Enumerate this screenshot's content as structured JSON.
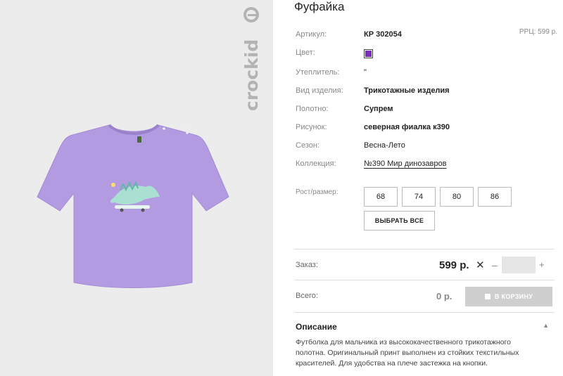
{
  "brand": {
    "name": "crockid"
  },
  "product": {
    "title": "Фуфайка",
    "rrp": "РРЦ: 599 р.",
    "specs": {
      "article": {
        "key": "Артикул:",
        "value": "КР 302054"
      },
      "color": {
        "key": "Цвет:",
        "hex": "#7b2cbf"
      },
      "insulation": {
        "key": "Утеплитель:",
        "value": "\""
      },
      "kind": {
        "key": "Вид изделия:",
        "value": "Трикотажные изделия"
      },
      "fabric": {
        "key": "Полотно:",
        "value": "Супрем"
      },
      "pattern": {
        "key": "Рисунок:",
        "value": "северная фиалка к390"
      },
      "season": {
        "key": "Сезон:",
        "value": "Весна-Лето"
      },
      "collection": {
        "key": "Коллекция:",
        "value": "№390 Мир динозавров"
      }
    },
    "sizes": {
      "label": "Рост/размер:",
      "options": [
        "68",
        "74",
        "80",
        "86"
      ],
      "select_all": "ВЫБРАТЬ ВСЕ"
    },
    "order": {
      "label": "Заказ:",
      "price": "599 р.",
      "remove_icon": "close-icon",
      "minus": "–",
      "plus": "+",
      "quantity_value": ""
    },
    "total": {
      "label": "Всего:",
      "value": "0 р.",
      "cart_button": "В КОРЗИНУ"
    },
    "description": {
      "title": "Описание",
      "text": "Футболка для мальчика из высококачественного трикотажного полотна. Оригинальный принт выполнен из стойких текстильных красителей. Для удобства на плече застежка на кнопки."
    }
  },
  "colors": {
    "tee": "#b49be0",
    "accent": "#7b2cbf",
    "panel": "#ececec"
  }
}
